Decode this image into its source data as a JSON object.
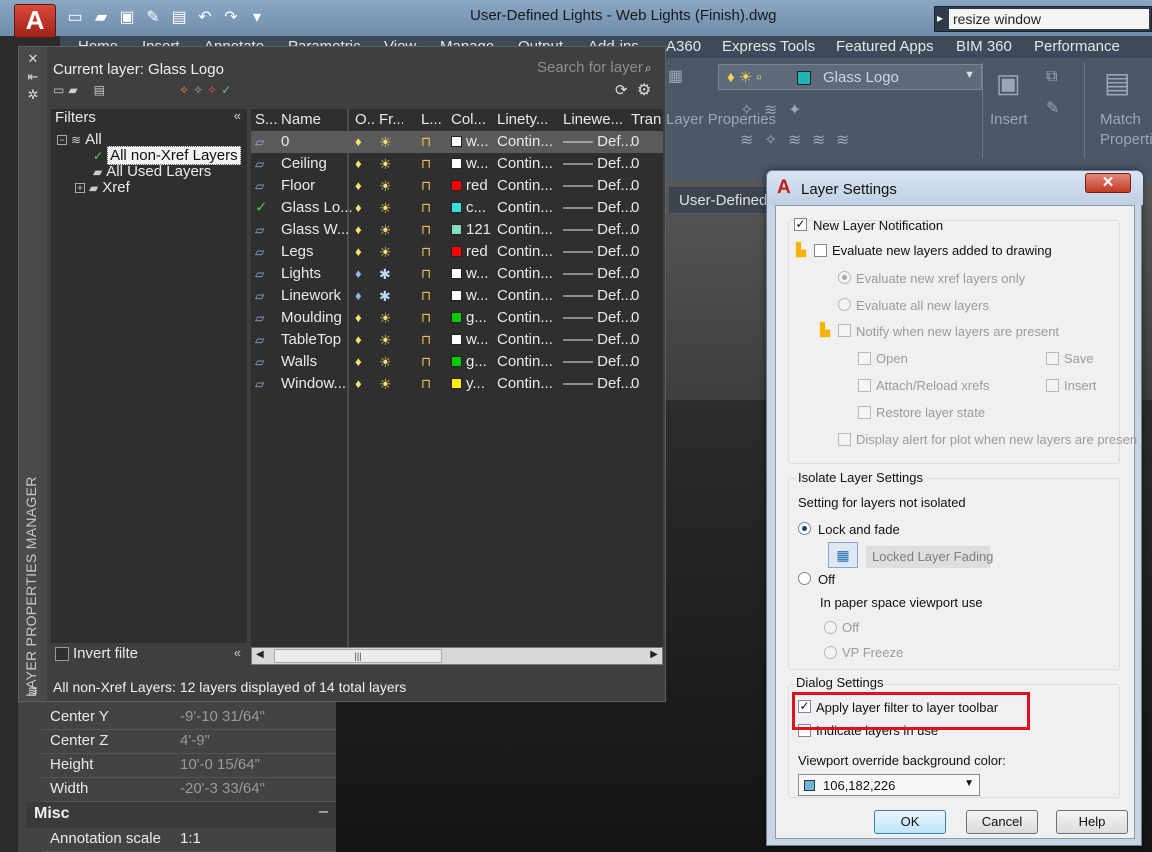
{
  "window": {
    "app_letter": "A",
    "title": "User-Defined Lights - Web Lights (Finish).dwg",
    "search_value": "resize window"
  },
  "ribbon": {
    "tabs": [
      "Home",
      "Insert",
      "Annotate",
      "Parametric",
      "View",
      "Manage",
      "Output",
      "Add-ins",
      "A360",
      "Express Tools",
      "Featured Apps",
      "BIM 360",
      "Performance"
    ],
    "current_layer_combo": "Glass Logo",
    "layer_swatch_color": "#1fb3b3",
    "panels": {
      "insert": "Insert",
      "match_properties": "Match Properties",
      "layer_props_label": "Layer Properties"
    }
  },
  "viewport": {
    "tab_label": "User-Defined"
  },
  "layer_manager": {
    "vertical_title": "LAYER PROPERTIES MANAGER",
    "current_layer": "Current layer: Glass Logo",
    "search_placeholder": "Search for layer",
    "filters_header": "Filters",
    "tree": {
      "all": "All",
      "non_xref": "All non-Xref Layers",
      "used": "All Used Layers",
      "xref": "Xref"
    },
    "invert_filter": "Invert filte",
    "columns": [
      "S...",
      "Name",
      "O...",
      "Fr...",
      "L...",
      "Col...",
      "Linety...",
      "Linewe...",
      "Tran"
    ],
    "layers": [
      {
        "name": "0",
        "color_name": "w...",
        "swatch": "#ffffff",
        "linetype": "Contin...",
        "lineweight": "Def...",
        "trans": "0",
        "status": "layer",
        "on": true,
        "frozen": false
      },
      {
        "name": "Ceiling",
        "color_name": "w...",
        "swatch": "#ffffff",
        "linetype": "Contin...",
        "lineweight": "Def...",
        "trans": "0",
        "status": "layer",
        "on": true,
        "frozen": false
      },
      {
        "name": "Floor",
        "color_name": "red",
        "swatch": "#ff0000",
        "linetype": "Contin...",
        "lineweight": "Def...",
        "trans": "0",
        "status": "layer",
        "on": true,
        "frozen": false
      },
      {
        "name": "Glass Lo...",
        "color_name": "c...",
        "swatch": "#33e0e0",
        "linetype": "Contin...",
        "lineweight": "Def...",
        "trans": "0",
        "status": "current",
        "on": true,
        "frozen": false
      },
      {
        "name": "Glass W...",
        "color_name": "121",
        "swatch": "#7fdfbf",
        "linetype": "Contin...",
        "lineweight": "Def...",
        "trans": "0",
        "status": "layer",
        "on": true,
        "frozen": false
      },
      {
        "name": "Legs",
        "color_name": "red",
        "swatch": "#ff0000",
        "linetype": "Contin...",
        "lineweight": "Def...",
        "trans": "0",
        "status": "layer",
        "on": true,
        "frozen": false
      },
      {
        "name": "Lights",
        "color_name": "w...",
        "swatch": "#ffffff",
        "linetype": "Contin...",
        "lineweight": "Def...",
        "trans": "0",
        "status": "layer",
        "on": false,
        "frozen": true
      },
      {
        "name": "Linework",
        "color_name": "w...",
        "swatch": "#ffffff",
        "linetype": "Contin...",
        "lineweight": "Def...",
        "trans": "0",
        "status": "layer",
        "on": false,
        "frozen": true
      },
      {
        "name": "Moulding",
        "color_name": "g...",
        "swatch": "#00cc00",
        "linetype": "Contin...",
        "lineweight": "Def...",
        "trans": "0",
        "status": "layer",
        "on": true,
        "frozen": false
      },
      {
        "name": "TableTop",
        "color_name": "w...",
        "swatch": "#ffffff",
        "linetype": "Contin...",
        "lineweight": "Def...",
        "trans": "0",
        "status": "layer",
        "on": true,
        "frozen": false
      },
      {
        "name": "Walls",
        "color_name": "g...",
        "swatch": "#00cc00",
        "linetype": "Contin...",
        "lineweight": "Def...",
        "trans": "0",
        "status": "layer",
        "on": true,
        "frozen": false
      },
      {
        "name": "Window...",
        "color_name": "y...",
        "swatch": "#ffee00",
        "linetype": "Contin...",
        "lineweight": "Def...",
        "trans": "0",
        "status": "layer",
        "on": true,
        "frozen": false
      }
    ],
    "status_bar": "All non-Xref Layers: 12 layers displayed of 14 total layers"
  },
  "properties": {
    "rows": [
      {
        "label": "Center Y",
        "value": "-9'-10 31/64\""
      },
      {
        "label": "Center Z",
        "value": "4'-9\""
      },
      {
        "label": "Height",
        "value": "10'-0 15/64\""
      },
      {
        "label": "Width",
        "value": "-20'-3 33/64\""
      }
    ],
    "misc_title": "Misc",
    "misc_rows": [
      {
        "label": "Annotation scale",
        "value": "1:1"
      }
    ]
  },
  "dialog": {
    "title": "Layer Settings",
    "close_glyph": "✕",
    "new_layer_notification": "New Layer Notification",
    "evaluate_new_layers": "Evaluate new layers added to drawing",
    "evaluate_xref_only": "Evaluate new xref layers only",
    "evaluate_all": "Evaluate all new layers",
    "notify_when_present": "Notify when new layers are present",
    "open": "Open",
    "save": "Save",
    "attach_reload": "Attach/Reload xrefs",
    "insert": "Insert",
    "restore_state": "Restore layer state",
    "display_alert_plot": "Display alert for plot when new layers are presen",
    "isolate_header": "Isolate Layer Settings",
    "setting_not_isolated": "Setting for layers not isolated",
    "lock_and_fade": "Lock and fade",
    "locked_layer_fading": "Locked Layer Fading",
    "off": "Off",
    "paper_space_viewport": "In paper space viewport use",
    "ps_off": "Off",
    "vp_freeze": "VP Freeze",
    "dialog_settings_header": "Dialog Settings",
    "apply_filter_toolbar": "Apply layer filter to layer toolbar",
    "indicate_layers_in_use": "Indicate layers in use",
    "viewport_bg_label": "Viewport override background color:",
    "viewport_bg_value": "106,182,226",
    "viewport_bg_color": "#6ab6e2",
    "ok": "OK",
    "cancel": "Cancel",
    "help": "Help",
    "states": {
      "new_layer_notification": true,
      "evaluate_new_layers": false,
      "lock_and_fade": true,
      "apply_filter_toolbar": true,
      "indicate_layers_in_use": false
    }
  }
}
